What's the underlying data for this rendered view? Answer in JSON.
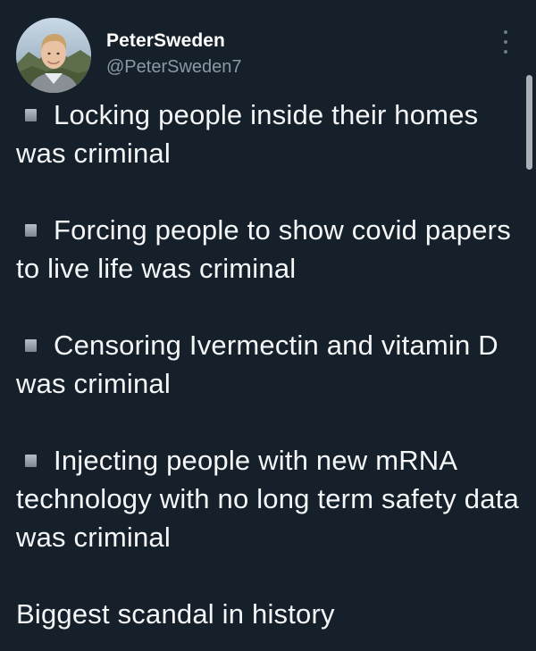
{
  "author": {
    "display_name": "PeterSweden",
    "handle": "@PeterSweden7",
    "avatar_icon": "profile-photo-avatar"
  },
  "more_menu_icon": "more-vertical-icon",
  "bullet_icon": "white-small-square-icon",
  "tweet": {
    "paragraphs": [
      {
        "bullet": true,
        "text": "Locking people inside their homes was criminal"
      },
      {
        "bullet": true,
        "text": "Forcing people to show covid papers to live life was criminal"
      },
      {
        "bullet": true,
        "text": "Censoring Ivermectin and vitamin D was criminal"
      },
      {
        "bullet": true,
        "text": "Injecting people with new mRNA technology with no long term safety data was criminal"
      },
      {
        "bullet": false,
        "text": "Biggest scandal in history"
      }
    ]
  },
  "colors": {
    "background": "#15202b",
    "text": "#ffffff",
    "secondary_text": "#8b98a5"
  }
}
